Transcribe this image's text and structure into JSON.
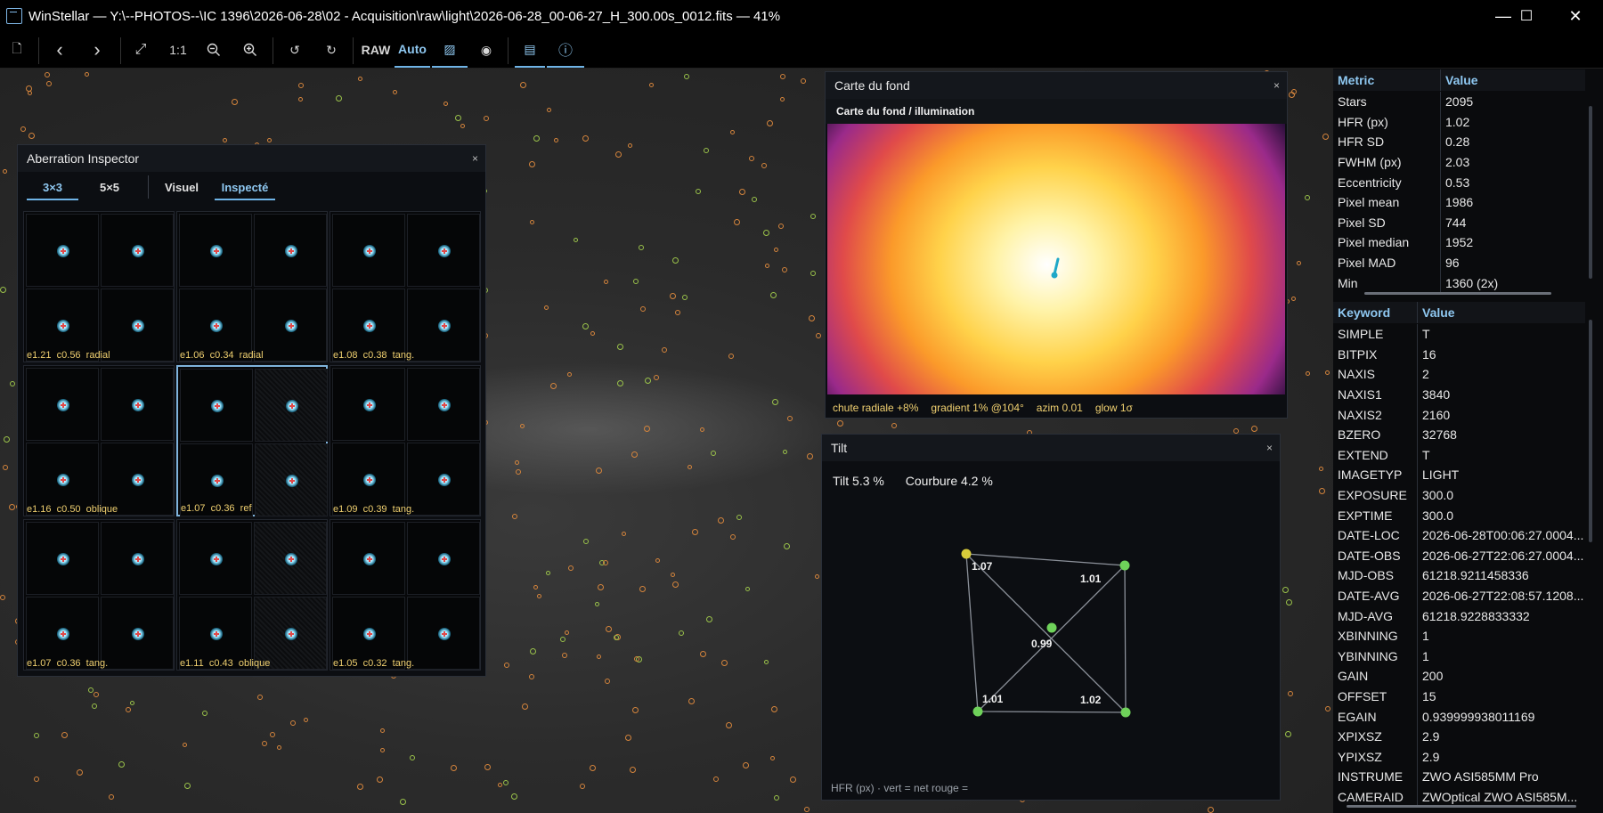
{
  "window": {
    "title": "WinStellar — Y:\\--PHOTOS--\\IC 1396\\2026-06-28\\02 - Acquisition\\raw\\light\\2026-06-28_00-06-27_H_300.00s_0012.fits — 41%",
    "minimize": "—",
    "maximize": "☐",
    "close": "✕"
  },
  "toolbar": {
    "new": "🗋",
    "back": "‹",
    "forward": "›",
    "fit": "⤢",
    "one_to_one": "1:1",
    "zoom_out": "−",
    "zoom_in": "+",
    "rotate_left": "↺",
    "rotate_right": "↻",
    "raw": "RAW",
    "auto": "Auto",
    "histogram": "▨",
    "eye": "◉",
    "report": "▤",
    "info": "ⓘ"
  },
  "aberration": {
    "title": "Aberration Inspector",
    "close": "×",
    "tabs": [
      {
        "label": "3×3",
        "active": true
      },
      {
        "label": "5×5",
        "active": false
      },
      {
        "label": "Visuel",
        "active": false
      },
      {
        "label": "Inspecté",
        "active": true
      }
    ],
    "cells": [
      {
        "label": "e1.21  c0.56  radial"
      },
      {
        "label": "e1.06  c0.34  radial"
      },
      {
        "label": "e1.08  c0.38  tang."
      },
      {
        "label": "e1.16  c0.50  oblique"
      },
      {
        "label": "e1.07  c0.36  ref",
        "selected": true
      },
      {
        "label": "e1.09  c0.39  tang."
      },
      {
        "label": "e1.07  c0.36  tang."
      },
      {
        "label": "e1.11  c0.43  oblique"
      },
      {
        "label": "e1.05  c0.32  tang."
      }
    ]
  },
  "background_map": {
    "title": "Carte du fond",
    "subtitle": "Carte du fond / illumination",
    "close": "×",
    "footer": [
      "chute radiale +8%",
      "gradient 1% @104°",
      "azim 0.01",
      "glow 1σ"
    ]
  },
  "tilt": {
    "title": "Tilt",
    "close": "×",
    "tilt_label": "Tilt 5.3 %",
    "curvature_label": "Courbure 4.2 %",
    "points": {
      "tl": "1.07",
      "tr": "1.01",
      "center": "0.99",
      "bl": "1.01",
      "br": "1.02"
    },
    "footer": "HFR (px) · vert = net  rouge =",
    "colors": {
      "tl": "#d9cc3a",
      "ok": "#6fd25a"
    }
  },
  "metrics": {
    "headers": [
      "Metric",
      "Value"
    ],
    "rows": [
      [
        "Stars",
        "2095"
      ],
      [
        "HFR (px)",
        "1.02"
      ],
      [
        "HFR SD",
        "0.28"
      ],
      [
        "FWHM (px)",
        "2.03"
      ],
      [
        "Eccentricity",
        "0.53"
      ],
      [
        "Pixel mean",
        "1986"
      ],
      [
        "Pixel SD",
        "744"
      ],
      [
        "Pixel median",
        "1952"
      ],
      [
        "Pixel MAD",
        "96"
      ],
      [
        "Min",
        "1360 (2x)"
      ]
    ]
  },
  "header": {
    "headers": [
      "Keyword",
      "Value"
    ],
    "rows": [
      [
        "SIMPLE",
        "T"
      ],
      [
        "BITPIX",
        "16"
      ],
      [
        "NAXIS",
        "2"
      ],
      [
        "NAXIS1",
        "3840"
      ],
      [
        "NAXIS2",
        "2160"
      ],
      [
        "BZERO",
        "32768"
      ],
      [
        "EXTEND",
        "T"
      ],
      [
        "IMAGETYP",
        "LIGHT"
      ],
      [
        "EXPOSURE",
        "300.0"
      ],
      [
        "EXPTIME",
        "300.0"
      ],
      [
        "DATE-LOC",
        "2026-06-28T00:06:27.0004..."
      ],
      [
        "DATE-OBS",
        "2026-06-27T22:06:27.0004..."
      ],
      [
        "MJD-OBS",
        "61218.9211458336"
      ],
      [
        "DATE-AVG",
        "2026-06-27T22:08:57.1208..."
      ],
      [
        "MJD-AVG",
        "61218.9228833332"
      ],
      [
        "XBINNING",
        "1"
      ],
      [
        "YBINNING",
        "1"
      ],
      [
        "GAIN",
        "200"
      ],
      [
        "OFFSET",
        "15"
      ],
      [
        "EGAIN",
        "0.939999938011169"
      ],
      [
        "XPIXSZ",
        "2.9"
      ],
      [
        "YPIXSZ",
        "2.9"
      ],
      [
        "INSTRUME",
        "ZWO ASI585MM Pro"
      ],
      [
        "CAMERAID",
        "ZWOptical ZWO ASI585M..."
      ]
    ]
  }
}
